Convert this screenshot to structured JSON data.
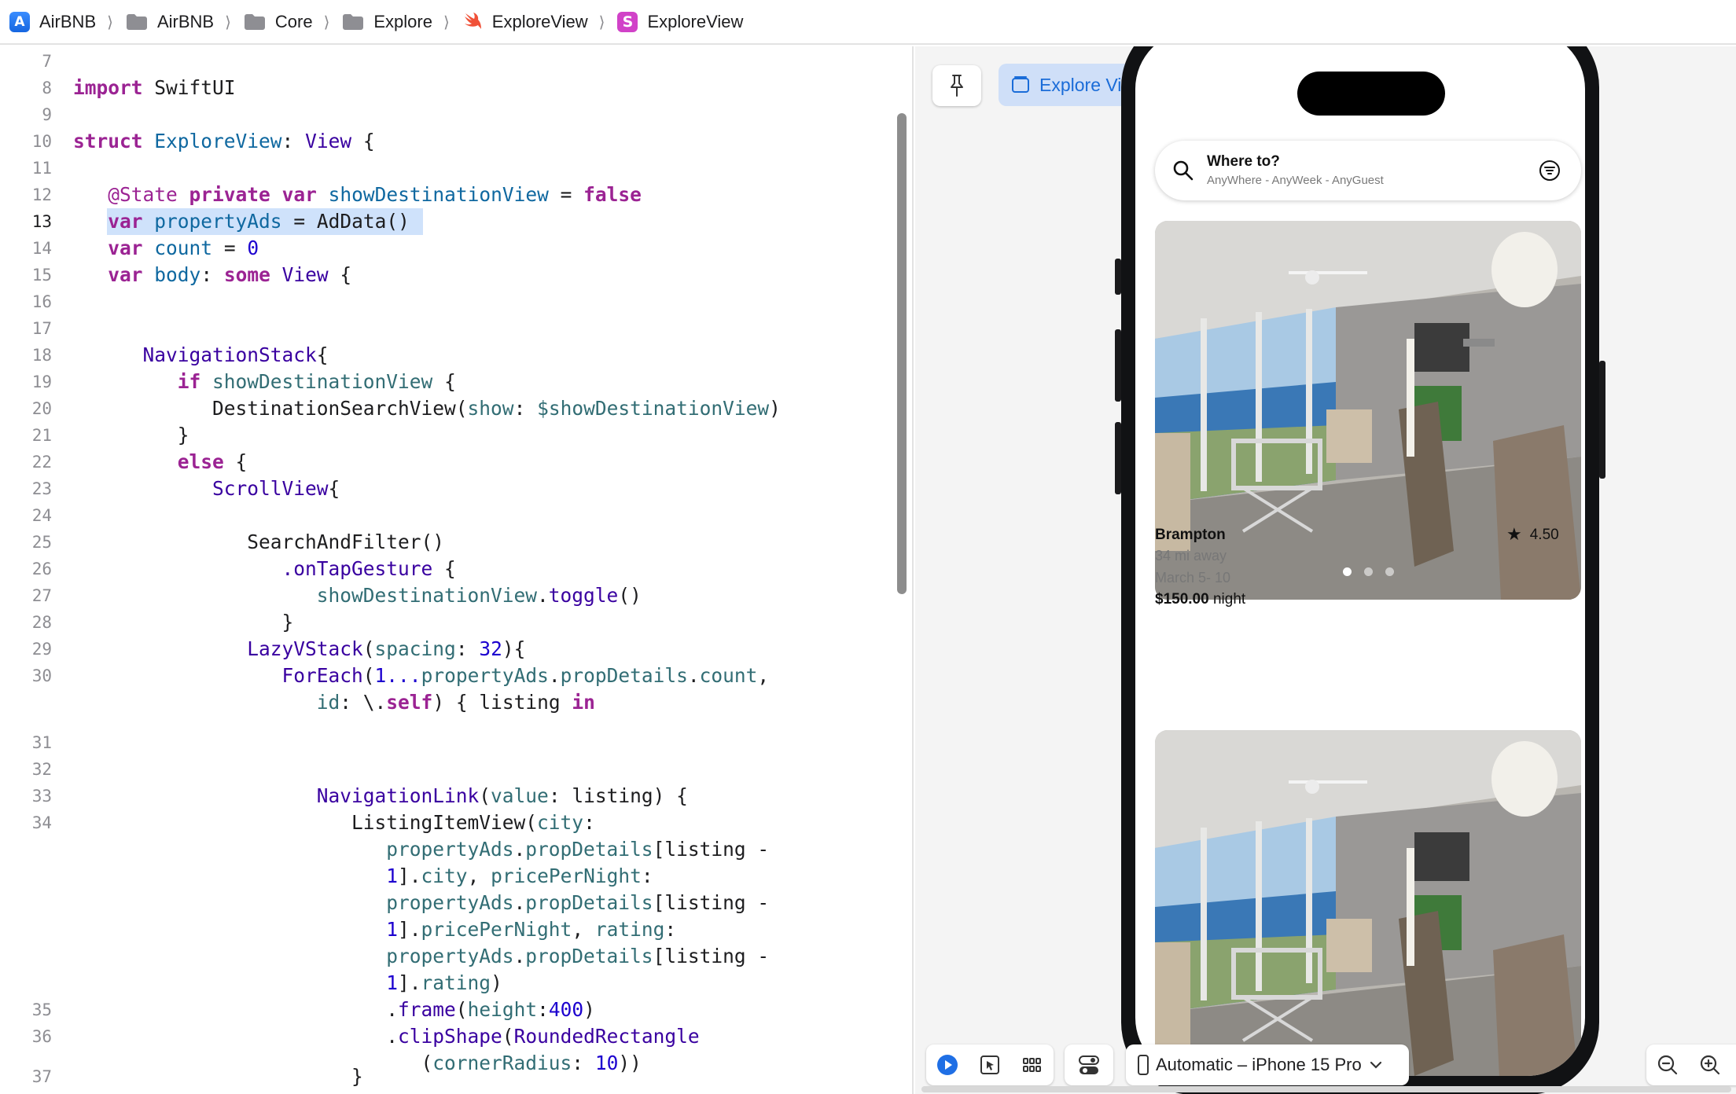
{
  "breadcrumb": {
    "items": [
      {
        "label": "AirBNB",
        "icon": "app-icon"
      },
      {
        "label": "AirBNB",
        "icon": "folder-icon"
      },
      {
        "label": "Core",
        "icon": "folder-icon"
      },
      {
        "label": "Explore",
        "icon": "folder-icon"
      },
      {
        "label": "ExploreView",
        "icon": "swift-file-icon"
      },
      {
        "label": "ExploreView",
        "icon": "swiftui-struct-icon"
      }
    ],
    "separator": "⟩"
  },
  "editor": {
    "active_line": "13",
    "line_numbers": [
      "7",
      "8",
      "9",
      "10",
      "11",
      "12",
      "13",
      "14",
      "15",
      "16",
      "17",
      "18",
      "19",
      "20",
      "21",
      "22",
      "23",
      "24",
      "25",
      "26",
      "27",
      "28",
      "29",
      "30",
      "31",
      "32",
      "33",
      "34",
      "35",
      "36",
      "37"
    ],
    "tokens": {
      "import": "import",
      "swiftui": "SwiftUI",
      "struct": "struct",
      "explore_view": "ExploreView",
      "colon": ": ",
      "view": "View",
      "brace_open": " {",
      "state_attr": "@State",
      "private": "private",
      "var": "var",
      "show_dest": "showDestinationView",
      "equals": " = ",
      "false": "false",
      "property_ads": "propertyAds",
      "addata_call": "AdData()",
      "count": "count",
      "zero": "0",
      "body": "body",
      "some": "some",
      "nav_stack": "NavigationStack",
      "brace_only": "{",
      "if": "if",
      "dest_search_view": "DestinationSearchView",
      "show_label": "show",
      "dollar_show_dest": "$showDestinationView",
      "close_paren": ")",
      "close_brace": "}",
      "else": "else",
      "scroll_view": "ScrollView",
      "search_and_filter": "SearchAndFilter",
      "empty_call": "()",
      "on_tap_gesture": ".onTapGesture",
      "toggle": "toggle",
      "lazy_vstack": "LazyVStack",
      "spacing": "spacing",
      "thirty_two": "32",
      "for_each": "ForEach",
      "range_start": "1...",
      "prop_details": "propDetails",
      "count_prop": "count",
      "id": "id",
      "self_kw": "self",
      "listing": "listing",
      "in": "in",
      "nav_link": "NavigationLink",
      "value": "value",
      "listing_item_view": "ListingItemView",
      "city": "city",
      "price_per_night": "pricePerNight",
      "rating": "rating",
      "one": "1",
      "frame": "frame",
      "height": "height",
      "four_hundred": "400",
      "clip_shape": "clipShape",
      "rounded_rect": "RoundedRectangle",
      "corner_radius": "cornerRadius",
      "ten": "10"
    }
  },
  "canvas": {
    "preview_label": "Explore View",
    "search": {
      "title": "Where to?",
      "subtitle": "AnyWhere - AnyWeek - AnyGuest"
    },
    "listing": {
      "city": "Brampton",
      "rating": "4.50",
      "distance": "34 mi away",
      "dates": "March 5- 10",
      "price": "$150.00",
      "price_unit": " night",
      "page_dots": 3,
      "active_dot": 0
    },
    "toolbar": {
      "device": "Automatic – iPhone 15 Pro"
    }
  }
}
